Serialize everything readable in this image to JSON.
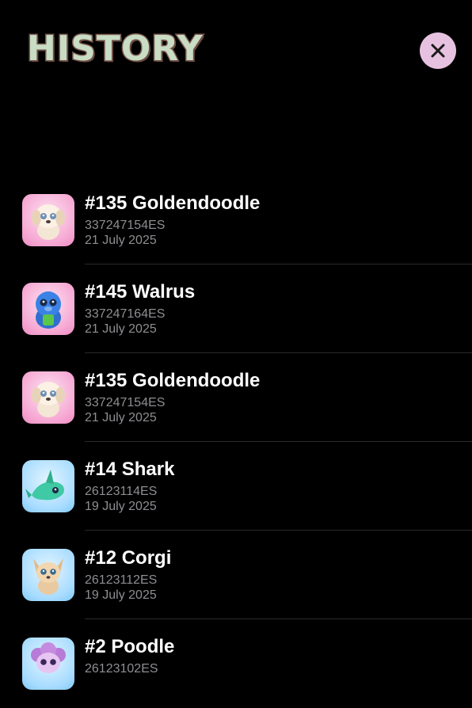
{
  "header": {
    "title": "HISTORY",
    "close_icon": "close-icon"
  },
  "colors": {
    "background": "#000000",
    "title_fill": "#c9dcc4",
    "title_outline": "#7a5a50",
    "close_button": "#e6c2e0",
    "secondary_text": "#8e8e93"
  },
  "history": {
    "items": [
      {
        "name": "#135 Goldendoodle",
        "code": "337247154ES",
        "date": "21 July 2025",
        "thumb_bg": "pink",
        "icon": "goldendoodle-icon"
      },
      {
        "name": "#145 Walrus",
        "code": "337247164ES",
        "date": "21 July 2025",
        "thumb_bg": "pink",
        "icon": "walrus-icon"
      },
      {
        "name": "#135 Goldendoodle",
        "code": "337247154ES",
        "date": "21 July 2025",
        "thumb_bg": "pink",
        "icon": "goldendoodle-icon"
      },
      {
        "name": "#14 Shark",
        "code": "26123114ES",
        "date": "19 July 2025",
        "thumb_bg": "blue",
        "icon": "shark-icon"
      },
      {
        "name": "#12 Corgi",
        "code": "26123112ES",
        "date": "19 July 2025",
        "thumb_bg": "blue",
        "icon": "corgi-icon"
      },
      {
        "name": "#2 Poodle",
        "code": "26123102ES",
        "date": "",
        "thumb_bg": "blue",
        "icon": "poodle-icon"
      }
    ]
  }
}
